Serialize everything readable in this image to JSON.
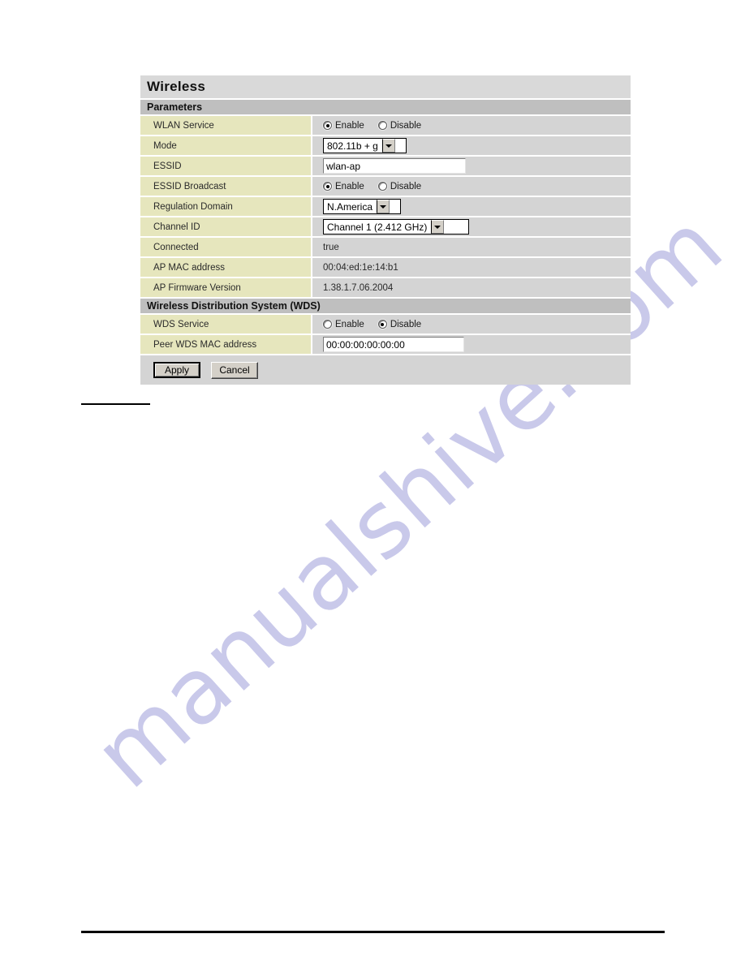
{
  "panel": {
    "title": "Wireless",
    "sections": [
      {
        "name": "parameters",
        "header": "Parameters",
        "rows": [
          {
            "label": "WLAN Service",
            "control": "radio",
            "options": [
              "Enable",
              "Disable"
            ],
            "selected": "Enable"
          },
          {
            "label": "Mode",
            "control": "select",
            "value": "802.11b + g"
          },
          {
            "label": "ESSID",
            "control": "text",
            "value": "wlan-ap"
          },
          {
            "label": "ESSID Broadcast",
            "control": "radio",
            "options": [
              "Enable",
              "Disable"
            ],
            "selected": "Enable"
          },
          {
            "label": "Regulation Domain",
            "control": "select",
            "value": "N.America"
          },
          {
            "label": "Channel ID",
            "control": "select",
            "value": "Channel 1 (2.412 GHz)"
          },
          {
            "label": "Connected",
            "control": "static",
            "value": "true"
          },
          {
            "label": "AP MAC address",
            "control": "static",
            "value": "00:04:ed:1e:14:b1"
          },
          {
            "label": "AP Firmware Version",
            "control": "static",
            "value": "1.38.1.7.06.2004"
          }
        ]
      },
      {
        "name": "wds",
        "header": "Wireless Distribution System (WDS)",
        "rows": [
          {
            "label": "WDS Service",
            "control": "radio",
            "options": [
              "Enable",
              "Disable"
            ],
            "selected": "Disable"
          },
          {
            "label": "Peer WDS MAC address",
            "control": "text",
            "value": "00:00:00:00:00:00"
          }
        ]
      }
    ],
    "buttons": {
      "apply": "Apply",
      "cancel": "Cancel"
    }
  },
  "watermark": {
    "text": "manualshive.com"
  },
  "colors": {
    "title_bar": "#d9d9d9",
    "section_bar": "#bfbfbf",
    "label_cell": "#e6e6bd",
    "value_cell": "#d4d4d4",
    "button_face": "#d4d0c8",
    "watermark": "#c9c9ea"
  }
}
